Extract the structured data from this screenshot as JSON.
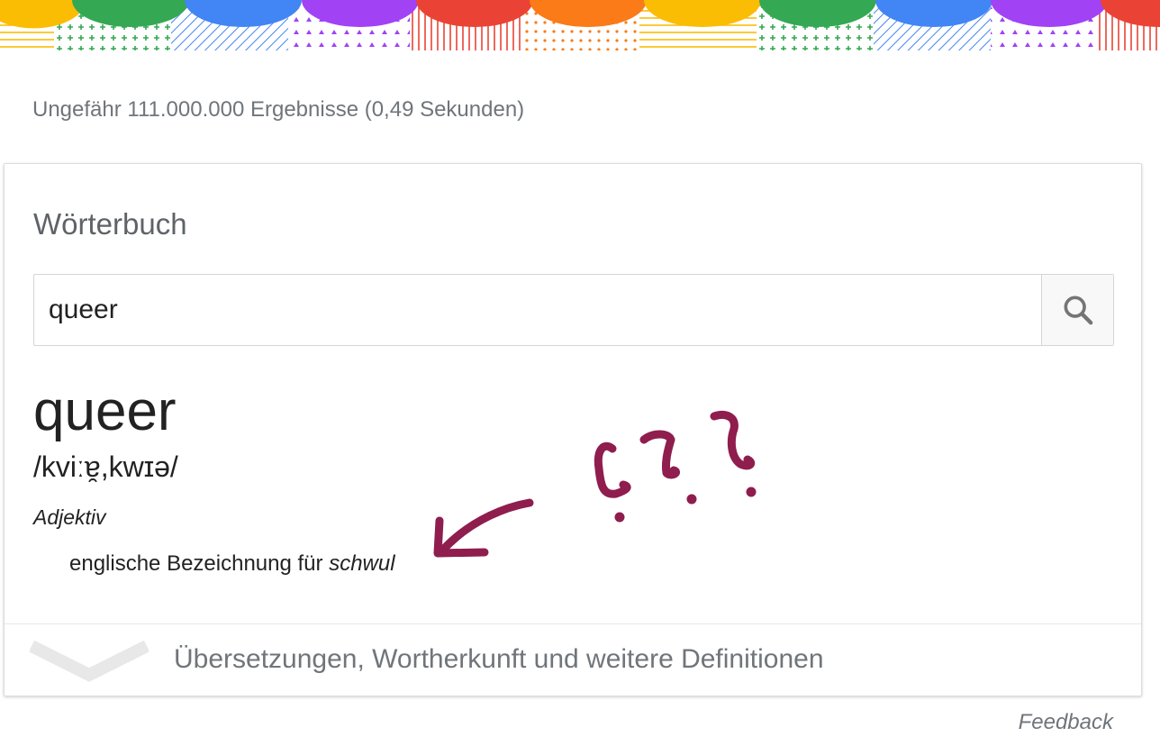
{
  "result_stats": "Ungefähr 111.000.000 Ergebnisse (0,49 Sekunden)",
  "dictionary": {
    "title": "Wörterbuch",
    "search_value": "queer",
    "headword": "queer",
    "phonetic": "/kviːɐ̯,kwɪə/",
    "part_of_speech": "Adjektiv",
    "definition_text": "englische Bezeichnung für ",
    "definition_emphasis": "schwul",
    "expand_label": "Übersetzungen, Wortherkunft und weitere Definitionen"
  },
  "feedback_label": "Feedback",
  "icons": {
    "search": "search-icon",
    "chevron": "chevron-down-icon",
    "annotation": "annotation-drawing"
  },
  "colors": {
    "annotation": "#8f1d4e",
    "banner": [
      "#fbbc04",
      "#34a853",
      "#4285f4",
      "#a142f4",
      "#ea4335",
      "#fa7b17"
    ]
  }
}
